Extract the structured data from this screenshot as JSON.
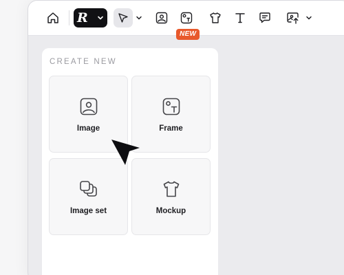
{
  "toolbar": {
    "tools": [
      {
        "name": "home",
        "icon": "home-icon"
      },
      {
        "name": "brand-menu",
        "icon": "brand-logo",
        "logo_text": "R"
      },
      {
        "name": "select",
        "icon": "pointer-icon"
      },
      {
        "name": "image",
        "icon": "image-icon"
      },
      {
        "name": "frame",
        "icon": "frame-icon"
      },
      {
        "name": "mockup",
        "icon": "tshirt-icon"
      },
      {
        "name": "text",
        "icon": "text-icon"
      },
      {
        "name": "comment",
        "icon": "comment-icon"
      },
      {
        "name": "export",
        "icon": "export-image-icon"
      }
    ],
    "new_badge": "NEW"
  },
  "create_panel": {
    "title": "CREATE NEW",
    "cards": [
      {
        "label": "Image",
        "icon": "image-icon"
      },
      {
        "label": "Frame",
        "icon": "frame-icon"
      },
      {
        "label": "Image set",
        "icon": "image-set-icon"
      },
      {
        "label": "Mockup",
        "icon": "tshirt-icon"
      }
    ]
  },
  "colors": {
    "accent_badge": "#e8592c",
    "brand_button": "#111114",
    "canvas": "#ebebee",
    "panel": "#ffffff"
  }
}
